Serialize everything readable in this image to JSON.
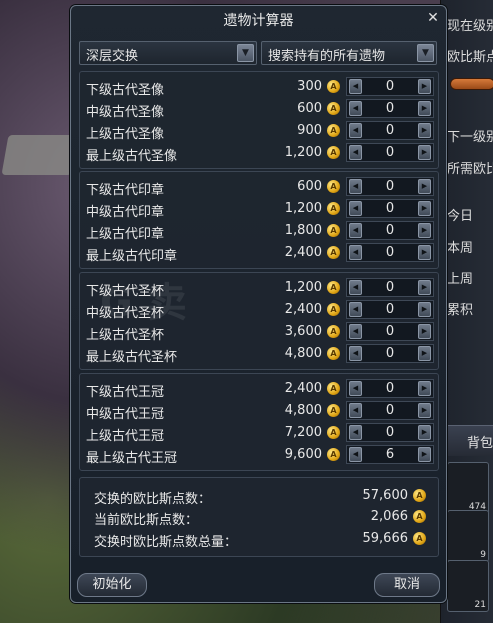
{
  "window": {
    "title": "遗物计算器"
  },
  "filters": {
    "mode": "深层交换",
    "scope": "搜索持有的所有遗物"
  },
  "coin_symbol": "A",
  "groups": [
    {
      "items": [
        {
          "name": "下级古代圣像",
          "price": "300",
          "qty": "0"
        },
        {
          "name": "中级古代圣像",
          "price": "600",
          "qty": "0"
        },
        {
          "name": "上级古代圣像",
          "price": "900",
          "qty": "0"
        },
        {
          "name": "最上级古代圣像",
          "price": "1,200",
          "qty": "0"
        }
      ]
    },
    {
      "items": [
        {
          "name": "下级古代印章",
          "price": "600",
          "qty": "0"
        },
        {
          "name": "中级古代印章",
          "price": "1,200",
          "qty": "0"
        },
        {
          "name": "上级古代印章",
          "price": "1,800",
          "qty": "0"
        },
        {
          "name": "最上级古代印章",
          "price": "2,400",
          "qty": "0"
        }
      ]
    },
    {
      "items": [
        {
          "name": "下级古代圣杯",
          "price": "1,200",
          "qty": "0"
        },
        {
          "name": "中级古代圣杯",
          "price": "2,400",
          "qty": "0"
        },
        {
          "name": "上级古代圣杯",
          "price": "3,600",
          "qty": "0"
        },
        {
          "name": "最上级古代圣杯",
          "price": "4,800",
          "qty": "0"
        }
      ]
    },
    {
      "items": [
        {
          "name": "下级古代王冠",
          "price": "2,400",
          "qty": "0"
        },
        {
          "name": "中级古代王冠",
          "price": "4,800",
          "qty": "0"
        },
        {
          "name": "上级古代王冠",
          "price": "7,200",
          "qty": "0"
        },
        {
          "name": "最上级古代王冠",
          "price": "9,600",
          "qty": "6"
        }
      ]
    }
  ],
  "summary": {
    "exchange_label": "交换的欧比斯点数：",
    "exchange_value": "57,600",
    "current_label": "当前欧比斯点数：",
    "current_value": "2,066",
    "total_label": "交换时欧比斯点数总量：",
    "total_value": "59,666"
  },
  "buttons": {
    "reset": "初始化",
    "cancel": "取消"
  },
  "background": {
    "hud_lines": [
      "现在级别",
      "欧比斯点",
      "下一级别",
      "所需欧比",
      "今日",
      "本周",
      "上周",
      "累积"
    ],
    "bag_tab": "背包",
    "slot_counts": [
      "474",
      "9",
      "21"
    ],
    "watermark": "G 卖"
  }
}
